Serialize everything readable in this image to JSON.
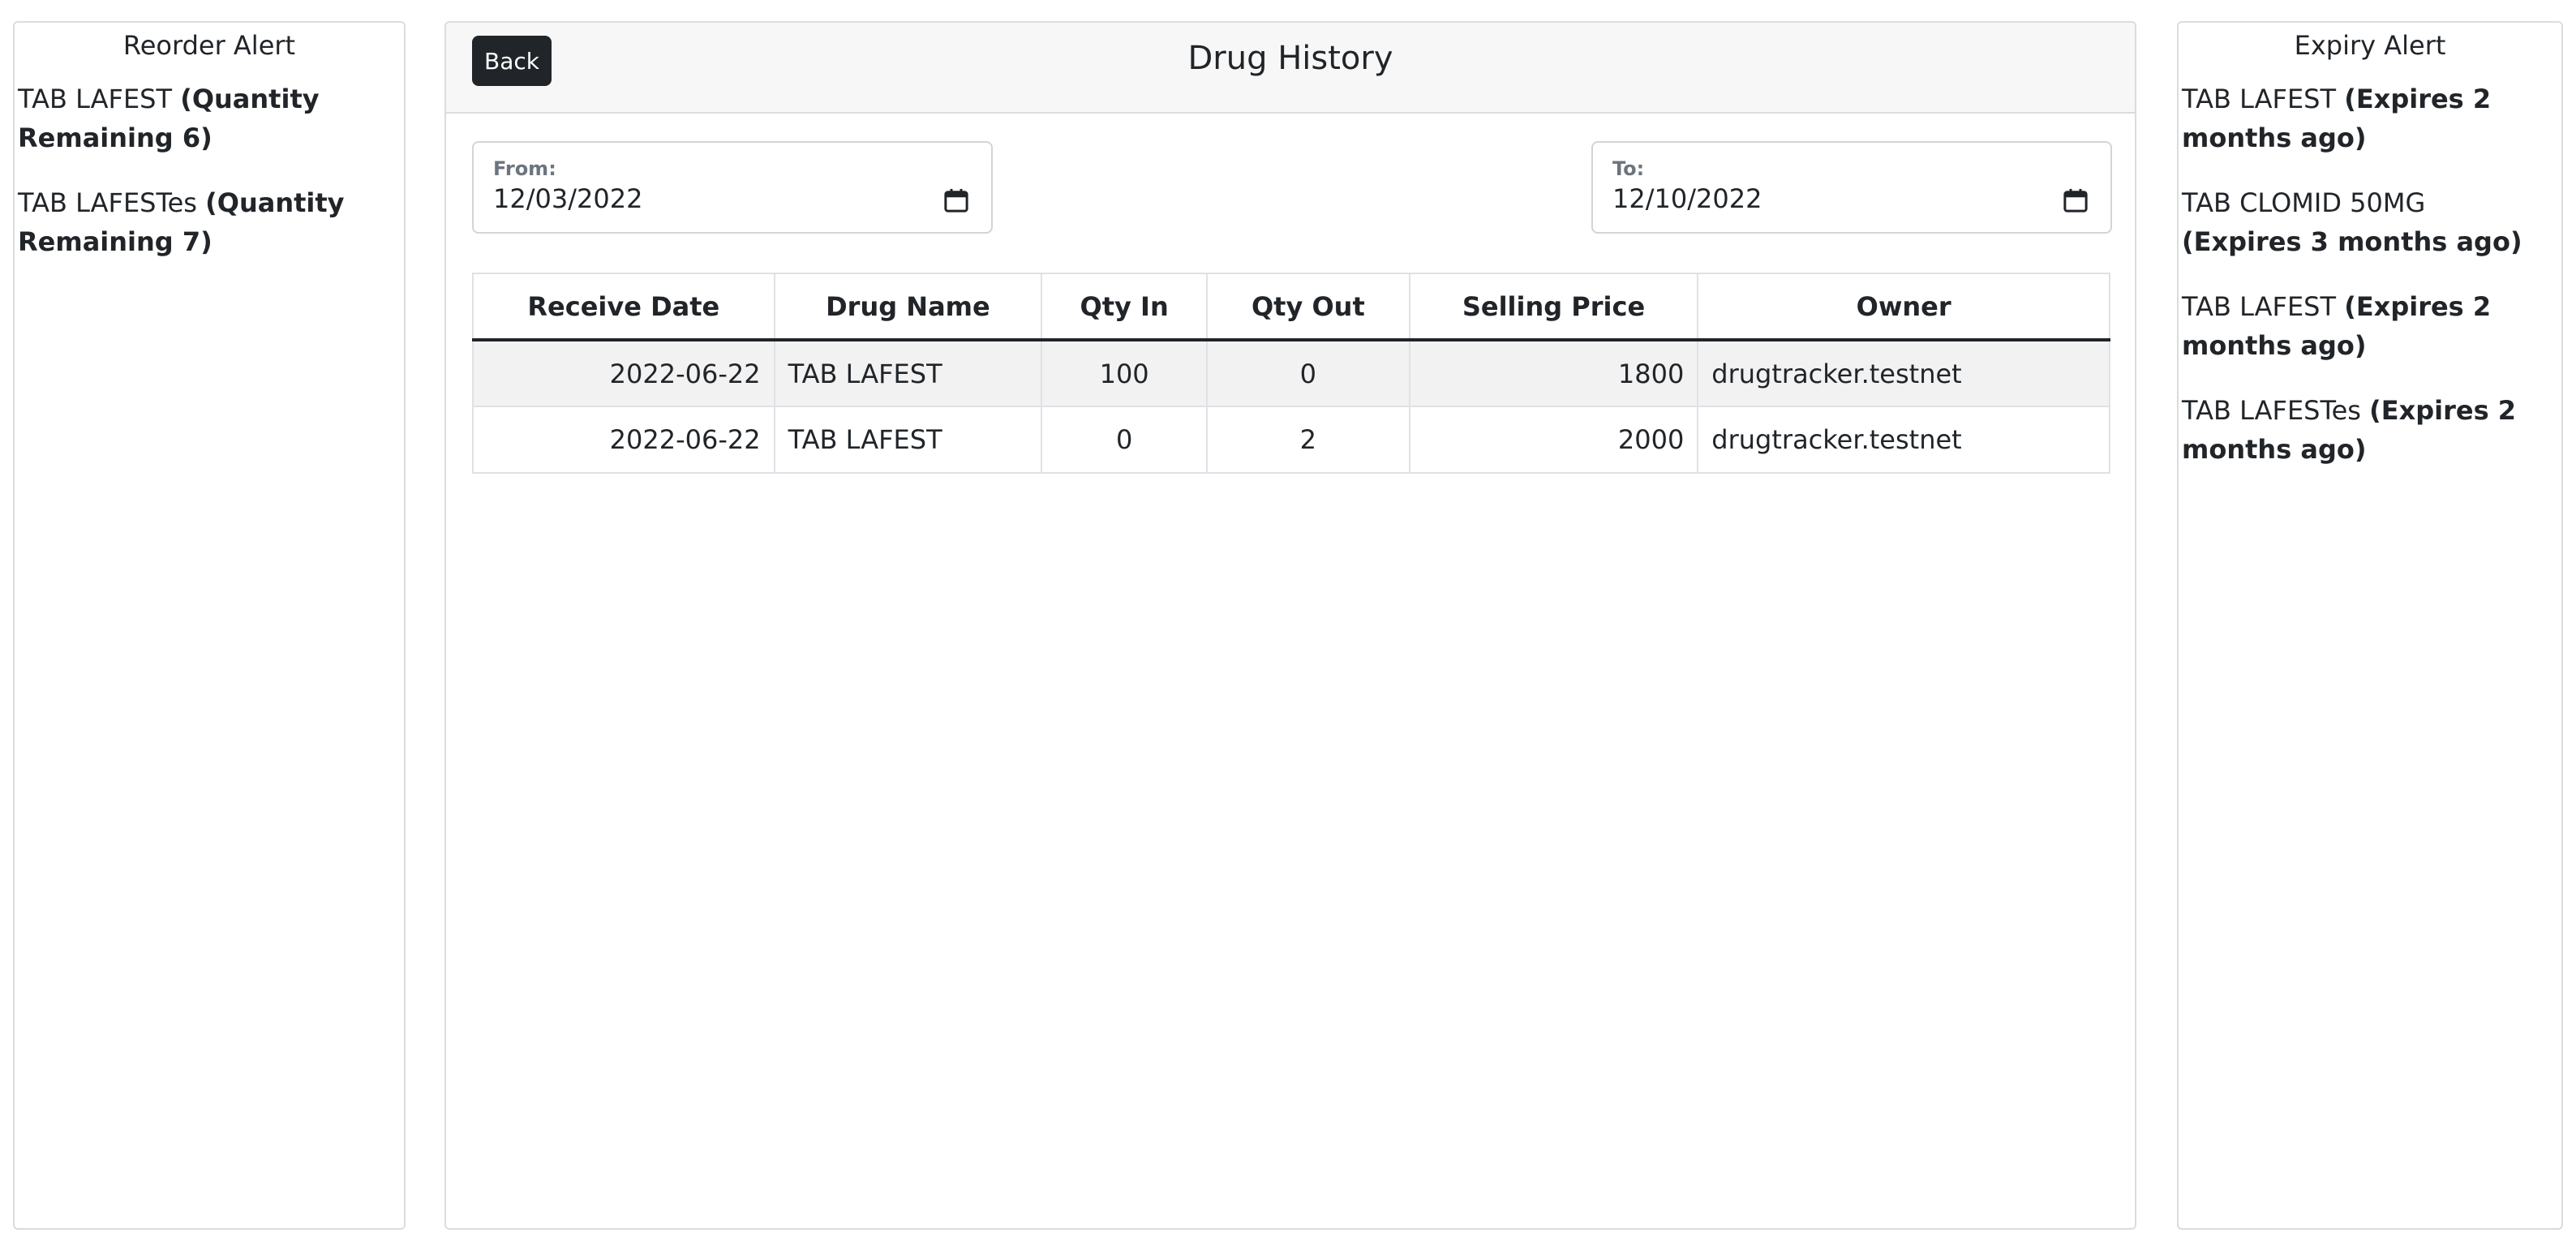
{
  "reorder": {
    "title": "Reorder Alert",
    "items": [
      {
        "name": "TAB LAFEST",
        "detail": "(Quantity Remaining 6)"
      },
      {
        "name": "TAB LAFESTes",
        "detail": "(Quantity Remaining 7)"
      }
    ]
  },
  "main": {
    "back_label": "Back",
    "title": "Drug History",
    "from": {
      "label": "From:",
      "value": "12/03/2022"
    },
    "to": {
      "label": "To:",
      "value": "12/10/2022"
    },
    "table": {
      "headers": [
        "Receive Date",
        "Drug Name",
        "Qty In",
        "Qty Out",
        "Selling Price",
        "Owner"
      ],
      "rows": [
        [
          "2022-06-22",
          "TAB LAFEST",
          "100",
          "0",
          "1800",
          "drugtracker.testnet"
        ],
        [
          "2022-06-22",
          "TAB LAFEST",
          "0",
          "2",
          "2000",
          "drugtracker.testnet"
        ]
      ]
    }
  },
  "expiry": {
    "title": "Expiry Alert",
    "items": [
      {
        "name": "TAB LAFEST",
        "detail": "(Expires 2 months ago)"
      },
      {
        "name": "TAB CLOMID 50MG",
        "detail": "(Expires 3 months ago)"
      },
      {
        "name": "TAB LAFEST",
        "detail": "(Expires 2 months ago)"
      },
      {
        "name": "TAB LAFESTes",
        "detail": "(Expires 2 months ago)"
      }
    ]
  },
  "icons": {
    "calendar": "calendar-icon"
  }
}
